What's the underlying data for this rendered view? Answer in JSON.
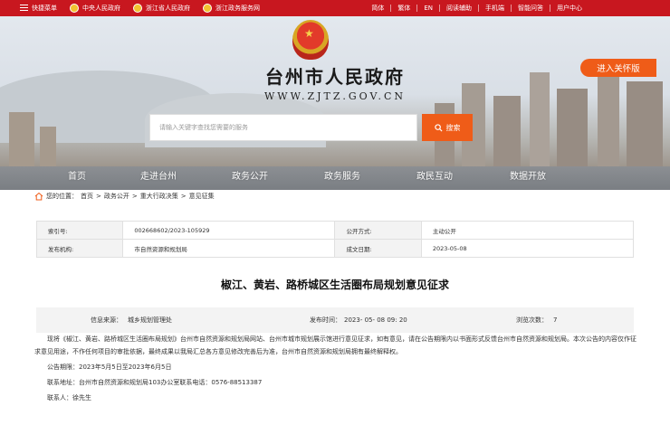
{
  "topbar": {
    "links": [
      {
        "label": "快捷菜单",
        "icon": "menu-icon"
      },
      {
        "label": "中央人民政府",
        "icon": "emblem-icon"
      },
      {
        "label": "浙江省人民政府",
        "icon": "emblem-icon"
      },
      {
        "label": "浙江政务服务网",
        "icon": "emblem-icon"
      }
    ],
    "right": [
      "简体",
      "繁体",
      "EN",
      "阅读辅助",
      "手机端",
      "智能问答",
      "用户中心"
    ],
    "color": "#c8171f"
  },
  "header": {
    "title": "台州市人民政府",
    "url": "WWW.ZJTZ.GOV.CN",
    "care_button": "进入关怀版",
    "accent": "#ef5c18"
  },
  "search": {
    "placeholder": "请输入关键字查找您需要的服务",
    "button": "搜索"
  },
  "nav": [
    "首页",
    "走进台州",
    "政务公开",
    "政务服务",
    "政民互动",
    "数据开放"
  ],
  "breadcrumb": {
    "prefix": "您的位置：",
    "items": [
      "首页",
      "政务公开",
      "重大行政决策",
      "意见征集"
    ],
    "sep": ">"
  },
  "info": {
    "index_key": "索引号:",
    "index_val": "002668602/2023-105929",
    "public_key": "公开方式:",
    "public_val": "主动公开",
    "org_key": "发布机构:",
    "org_val": "市自然资源和规划局",
    "date_key": "成文日期:",
    "date_val": "2023-05-08"
  },
  "article": {
    "title": "椒江、黄岩、路桥城区生活圈布局规划意见征求",
    "source_label": "信息来源：",
    "source": "城乡规划管理处",
    "time_label": "发布时间：",
    "time": "2023- 05- 08 09: 20",
    "views_label": "浏览次数：",
    "views": "7",
    "para": "现将《椒江、黄岩、路桥城区生活圈布局规划》台州市自然资源和规划局网站、台州市城市规划展示馆进行意见征求，如有意见，请在公告期限内以书面形式反馈台州市自然资源和规划局。本次公告的内容仅作征求意见用途，不作任何项目的审批依据，最终成果以我局汇总各方意见修改完善后为准，台州市自然资源和规划局拥有最终解释权。",
    "period": "公告期限：2023年5月5日至2023年6月5日",
    "address": "联系地址：台州市自然资源和规划局103办公室联系电话：0576-88513387",
    "contact": "联系人：徐先生"
  }
}
